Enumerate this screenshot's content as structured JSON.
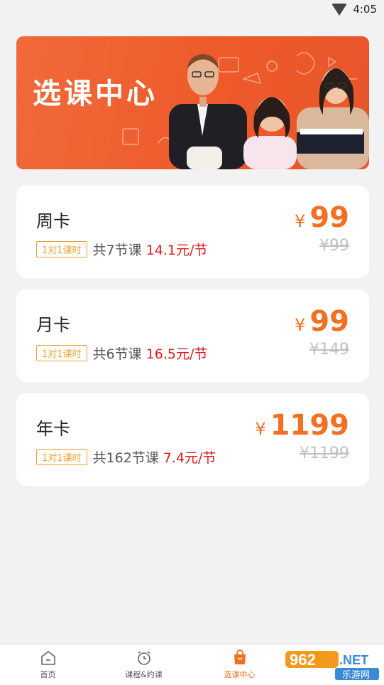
{
  "status_bar": {
    "time": "4:05"
  },
  "banner": {
    "title": "选课中心"
  },
  "cards": [
    {
      "name": "周卡",
      "tag": "1对1课时",
      "lessons": "共7节课",
      "per_price": "14.1元/节",
      "currency": "¥",
      "price": "99",
      "original_price": "¥99"
    },
    {
      "name": "月卡",
      "tag": "1对1课时",
      "lessons": "共6节课",
      "per_price": "16.5元/节",
      "currency": "¥",
      "price": "99",
      "original_price": "¥149"
    },
    {
      "name": "年卡",
      "tag": "1对1课时",
      "lessons": "共162节课",
      "per_price": "7.4元/节",
      "currency": "¥",
      "price": "1199",
      "original_price": "¥1199"
    }
  ],
  "tabbar": {
    "tabs": [
      {
        "label": "首页",
        "icon": "home-icon"
      },
      {
        "label": "课程&约课",
        "icon": "alarm-clock-icon"
      },
      {
        "label": "选课中心",
        "icon": "shopping-bag-icon",
        "active": true
      }
    ]
  },
  "watermark": {
    "text_number": "962",
    "text_net": ".NET",
    "text_cn": "乐游网"
  },
  "colors": {
    "accent": "#f36f22",
    "banner": "#ee5a2a",
    "per_price": "#e21c1c",
    "tag": "#f0a030"
  }
}
